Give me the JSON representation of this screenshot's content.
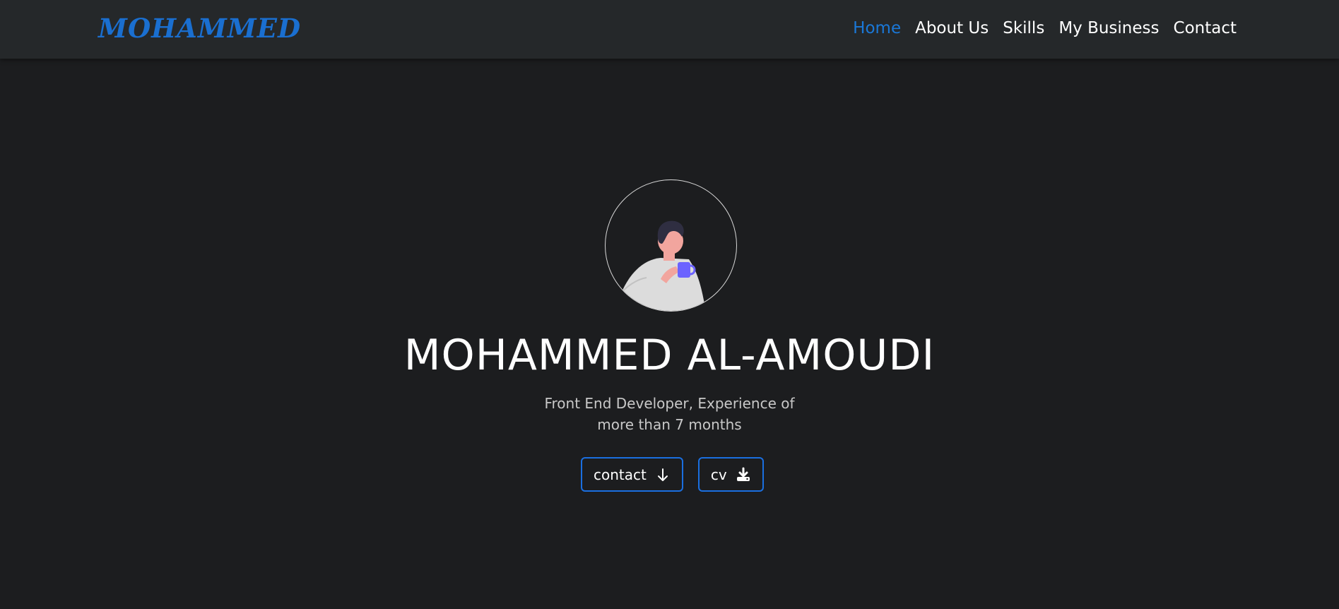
{
  "header": {
    "brand": "MOHAMMED",
    "nav": [
      {
        "label": "Home",
        "active": true
      },
      {
        "label": "About Us",
        "active": false
      },
      {
        "label": "Skills",
        "active": false
      },
      {
        "label": "My Business",
        "active": false
      },
      {
        "label": "Contact",
        "active": false
      }
    ]
  },
  "hero": {
    "name": "MOHAMMED AL-AMOUDI",
    "tagline": "Front End Developer, Experience of more than 7 months",
    "buttons": {
      "contact": {
        "label": "contact",
        "icon": "arrow-down-icon"
      },
      "cv": {
        "label": "cv",
        "icon": "download-icon"
      }
    }
  },
  "colors": {
    "background": "#1c1d1f",
    "navbar": "#25282a",
    "accent": "#1a6fd0",
    "button_border": "#1a6fe0"
  }
}
